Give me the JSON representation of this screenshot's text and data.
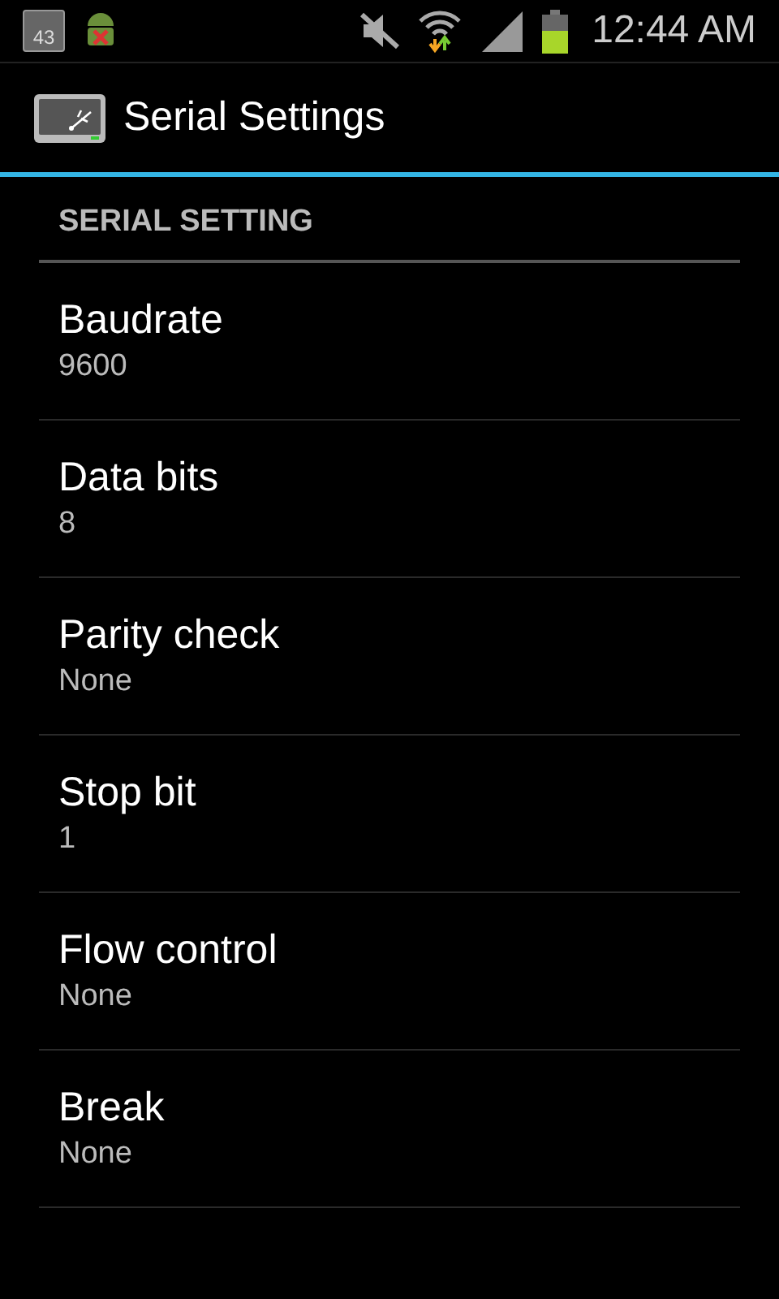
{
  "status_bar": {
    "calendar_day": "43",
    "time": "12:44 AM"
  },
  "action_bar": {
    "title": "Serial Settings"
  },
  "section": {
    "title": "SERIAL SETTING"
  },
  "preferences": [
    {
      "title": "Baudrate",
      "summary": "9600"
    },
    {
      "title": "Data bits",
      "summary": "8"
    },
    {
      "title": "Parity check",
      "summary": "None"
    },
    {
      "title": "Stop bit",
      "summary": "1"
    },
    {
      "title": "Flow control",
      "summary": "None"
    },
    {
      "title": "Break",
      "summary": "None"
    }
  ]
}
